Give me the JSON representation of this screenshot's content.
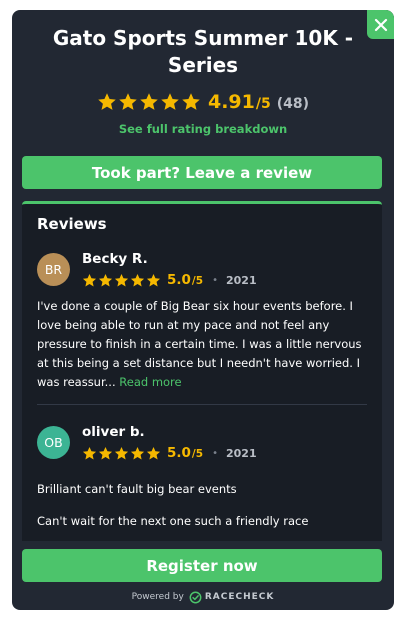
{
  "widget": {
    "title": "Gato Sports Summer 10K - Series",
    "close_icon": "close-icon",
    "rating": {
      "score": "4.91",
      "out_of": "/5",
      "count": "(48)",
      "stars": 5
    },
    "breakdown_link": "See full rating breakdown",
    "leave_review_label": "Took part? Leave a review",
    "register_label": "Register now",
    "powered_by": "Powered by",
    "brand": "RACECHECK"
  },
  "reviews": {
    "heading": "Reviews",
    "items": [
      {
        "initials": "BR",
        "avatar_color": "#b98f57",
        "name": "Becky R.",
        "score": "5.0",
        "out_of": "/5",
        "stars": 5,
        "year": "2021",
        "text": "I've done a couple of Big Bear six hour events before. I love being able to run at my pace and not feel any pressure to finish in a certain time. I was a little nervous at this being a set distance but I needn't have worried. I was reassur...",
        "read_more": "Read more"
      },
      {
        "initials": "OB",
        "avatar_color": "#3cb494",
        "name": "oliver b.",
        "score": "5.0",
        "out_of": "/5",
        "stars": 5,
        "year": "2021",
        "text_lines": [
          "Brilliant can't fault big bear events",
          "Can't wait for the next one such a friendly race"
        ]
      }
    ]
  },
  "colors": {
    "accent": "#4cc46b",
    "star": "#f5b800",
    "panel": "#222833"
  }
}
